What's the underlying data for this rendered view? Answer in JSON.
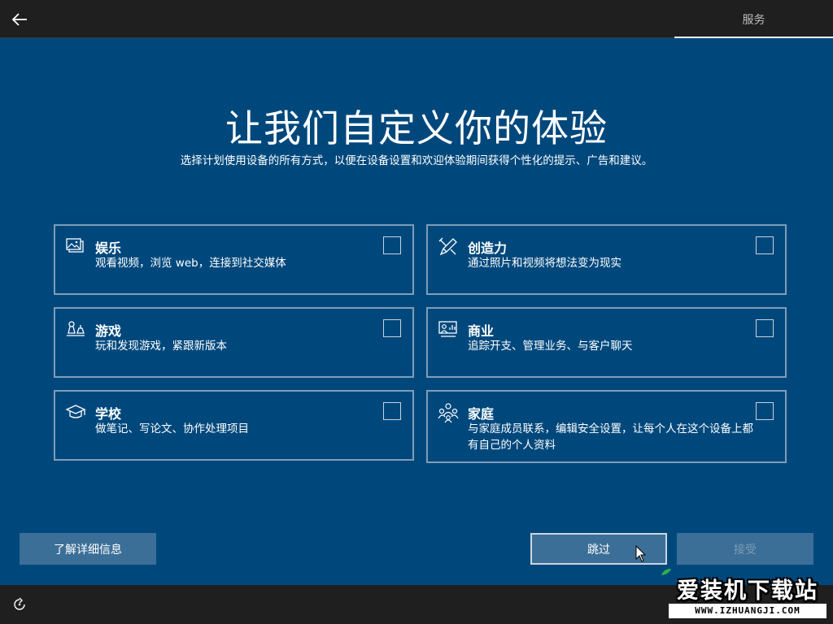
{
  "header": {
    "back_label": "back",
    "tab_label": "服务"
  },
  "main": {
    "title": "让我们自定义你的体验",
    "subtitle": "选择计划使用设备的所有方式，以便在设备设置和欢迎体验期间获得个性化的提示、广告和建议。"
  },
  "options": [
    {
      "name": "娱乐",
      "desc": "观看视频，浏览 web，连接到社交媒体",
      "icon": "entertainment-icon",
      "checked": false
    },
    {
      "name": "创造力",
      "desc": "通过照片和视频将想法变为现实",
      "icon": "creativity-icon",
      "checked": false
    },
    {
      "name": "游戏",
      "desc": "玩和发现游戏，紧跟新版本",
      "icon": "gaming-icon",
      "checked": false
    },
    {
      "name": "商业",
      "desc": "追踪开支、管理业务、与客户聊天",
      "icon": "business-icon",
      "checked": false
    },
    {
      "name": "学校",
      "desc": "做笔记、写论文、协作处理项目",
      "icon": "school-icon",
      "checked": false
    },
    {
      "name": "家庭",
      "desc": "与家庭成员联系，编辑安全设置，让每个人在这个设备上都有自己的个人资料",
      "icon": "family-icon",
      "checked": false
    }
  ],
  "buttons": {
    "learn_more": "了解详细信息",
    "skip": "跳过",
    "accept": "接受"
  },
  "watermark": {
    "text": "爱装机下载站",
    "url": "WWW.IZHUANGJI.COM"
  },
  "colors": {
    "background": "#00487c",
    "bar": "#1f1f1f",
    "button": "#3c6f97",
    "card_border": "#7e9db9"
  }
}
